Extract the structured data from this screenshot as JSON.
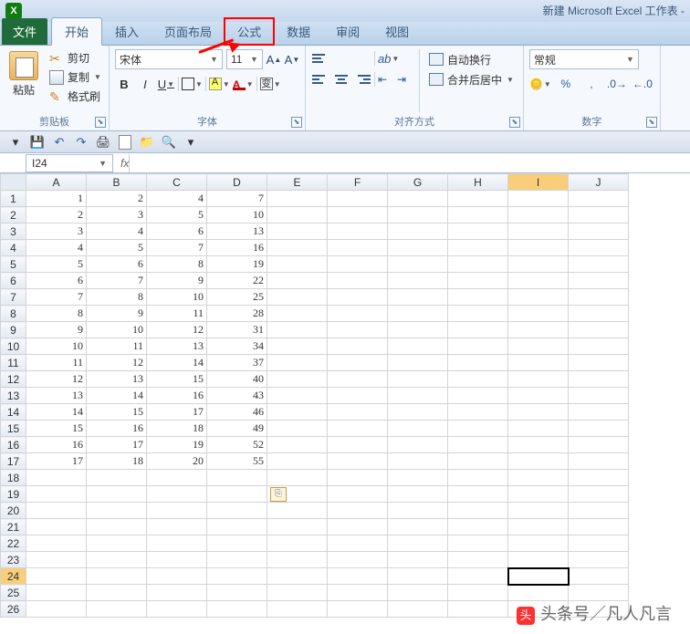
{
  "app": {
    "title": "新建 Microsoft Excel 工作表 -",
    "icon_letter": "X"
  },
  "tabs": {
    "file": "文件",
    "items": [
      "开始",
      "插入",
      "页面布局",
      "公式",
      "数据",
      "审阅",
      "视图"
    ],
    "active": "开始",
    "highlighted": "公式"
  },
  "clipboard": {
    "paste": "粘贴",
    "cut": "剪切",
    "copy": "复制",
    "format_painter": "格式刷",
    "group_label": "剪贴板"
  },
  "font": {
    "name": "宋体",
    "size": "11",
    "group_label": "字体",
    "wen": "变"
  },
  "align": {
    "wrap": "自动换行",
    "merge": "合并后居中",
    "group_label": "对齐方式"
  },
  "number": {
    "format": "常规",
    "group_label": "数字"
  },
  "namebox": {
    "ref": "I24"
  },
  "columns": [
    "A",
    "B",
    "C",
    "D",
    "E",
    "F",
    "G",
    "H",
    "I",
    "J"
  ],
  "active_col": "I",
  "active_row": 24,
  "row_count": 26,
  "chart_data": {
    "type": "table",
    "columns": [
      "A",
      "B",
      "C",
      "D"
    ],
    "rows": [
      [
        1,
        2,
        4,
        7
      ],
      [
        2,
        3,
        5,
        10
      ],
      [
        3,
        4,
        6,
        13
      ],
      [
        4,
        5,
        7,
        16
      ],
      [
        5,
        6,
        8,
        19
      ],
      [
        6,
        7,
        9,
        22
      ],
      [
        7,
        8,
        10,
        25
      ],
      [
        8,
        9,
        11,
        28
      ],
      [
        9,
        10,
        12,
        31
      ],
      [
        10,
        11,
        13,
        34
      ],
      [
        11,
        12,
        14,
        37
      ],
      [
        12,
        13,
        15,
        40
      ],
      [
        13,
        14,
        16,
        43
      ],
      [
        14,
        15,
        17,
        46
      ],
      [
        15,
        16,
        18,
        49
      ],
      [
        16,
        17,
        19,
        52
      ],
      [
        17,
        18,
        20,
        55
      ]
    ]
  },
  "watermark": {
    "logo": "头",
    "text": "头条号／凡人凡言"
  }
}
